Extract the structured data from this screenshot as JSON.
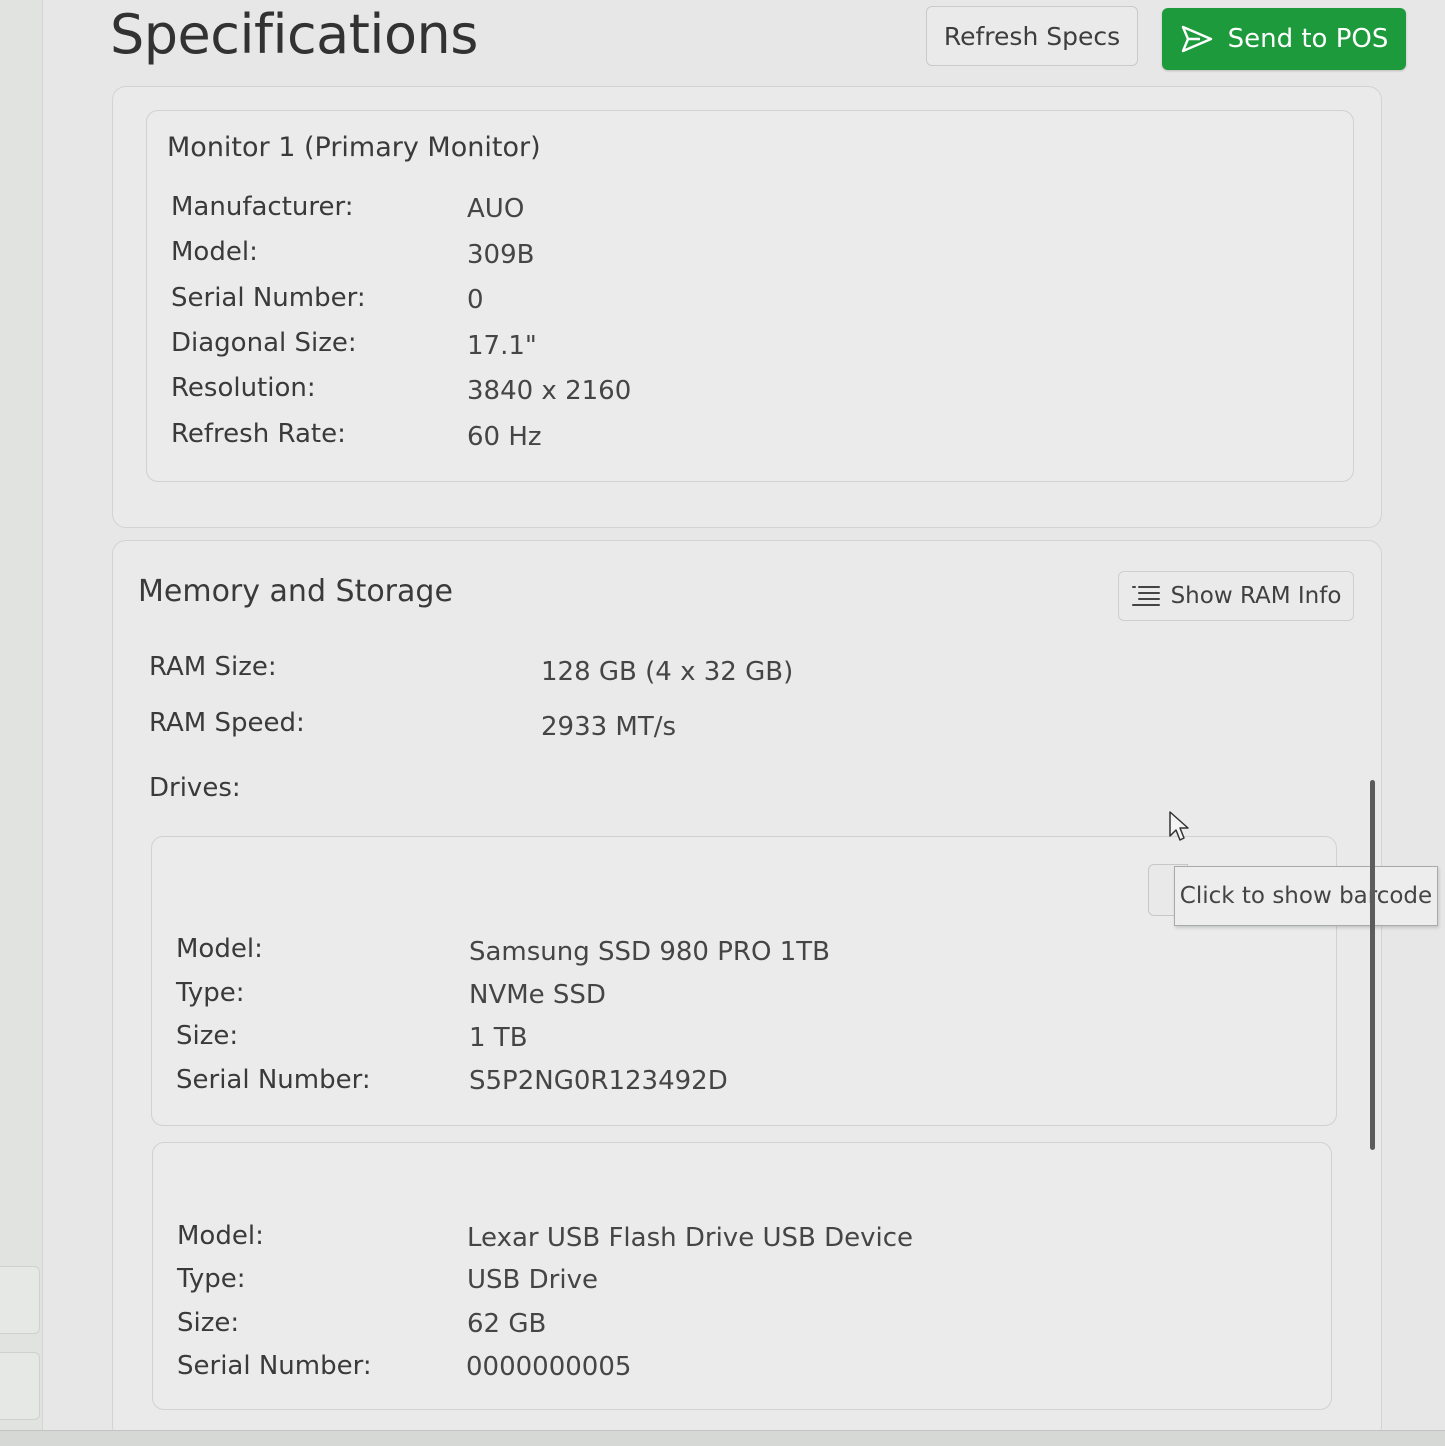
{
  "header": {
    "title": "Specifications",
    "refresh_label": "Refresh Specs",
    "send_label": "Send to POS",
    "send_icon": "send-icon",
    "accent_color": "#1c9a3c"
  },
  "monitor": {
    "title": "Monitor 1 (Primary Monitor)",
    "fields": [
      {
        "label": "Manufacturer:",
        "value": "AUO"
      },
      {
        "label": "Model:",
        "value": "309B"
      },
      {
        "label": "Serial Number:",
        "value": "0"
      },
      {
        "label": "Diagonal Size:",
        "value": "17.1\""
      },
      {
        "label": "Resolution:",
        "value": "3840 x 2160"
      },
      {
        "label": "Refresh Rate:",
        "value": "60 Hz"
      }
    ]
  },
  "memory": {
    "title": "Memory and Storage",
    "show_ram_label": "Show RAM Info",
    "show_ram_icon": "list-icon",
    "ram_size_label": "RAM Size:",
    "ram_size_value": "128 GB (4 x 32 GB)",
    "ram_speed_label": "RAM Speed:",
    "ram_speed_value": "2933 MT/s",
    "drives_label": "Drives:",
    "tooltip": "Click to show barcode",
    "drives": [
      {
        "fields": [
          {
            "label": "Model:",
            "value": "Samsung SSD 980 PRO 1TB"
          },
          {
            "label": "Type:",
            "value": "NVMe SSD"
          },
          {
            "label": "Size:",
            "value": "1 TB"
          },
          {
            "label": "Serial Number:",
            "value": "S5P2NG0R123492D"
          }
        ]
      },
      {
        "fields": [
          {
            "label": "Model:",
            "value": "Lexar USB Flash Drive USB Device"
          },
          {
            "label": "Type:",
            "value": "USB Drive"
          },
          {
            "label": "Size:",
            "value": "62 GB"
          },
          {
            "label": "Serial Number:",
            "value": "0000000005"
          }
        ]
      }
    ]
  }
}
